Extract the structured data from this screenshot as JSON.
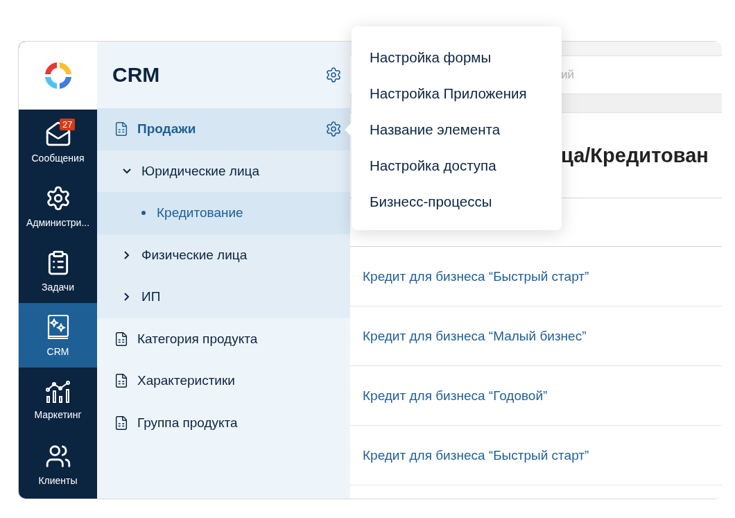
{
  "rail": [
    {
      "label": "Сообщения",
      "kind": "mail",
      "badge": "27",
      "selected": false
    },
    {
      "label": "Администри...",
      "kind": "gear",
      "selected": false
    },
    {
      "label": "Задачи",
      "kind": "tasks",
      "selected": false
    },
    {
      "label": "CRM",
      "kind": "crm",
      "selected": true
    },
    {
      "label": "Маркетинг",
      "kind": "chart",
      "selected": false
    },
    {
      "label": "Клиенты",
      "kind": "people",
      "selected": false
    }
  ],
  "sidebar": {
    "title": "CRM",
    "items": [
      {
        "label": "Продажи",
        "kind": "sheet",
        "expanded": true,
        "children": [
          {
            "label": "Юридические лица",
            "kind": "folder",
            "expanded": true,
            "selected": false,
            "children": [
              {
                "label": "Кредитование",
                "kind": "leaf",
                "selected": true
              }
            ]
          },
          {
            "label": "Физические лица",
            "kind": "folder",
            "expanded": false,
            "selected": false
          },
          {
            "label": "ИП",
            "kind": "folder",
            "expanded": false,
            "selected": false
          }
        ]
      },
      {
        "label": "Категория продукта",
        "kind": "sheet",
        "expanded": false
      },
      {
        "label": "Характеристики",
        "kind": "sheet",
        "expanded": false
      },
      {
        "label": "Группа продукта",
        "kind": "sheet",
        "expanded": false
      }
    ]
  },
  "context_menu": {
    "items": [
      "Настройка формы",
      "Настройка Приложения",
      "Название элемента",
      "Настройка доступа",
      "Бизнесс-процессы"
    ]
  },
  "main": {
    "search": {
      "placeholder": "ий"
    },
    "title": "ца/Кредитован",
    "rows": [
      "Кредит для бизнеса “Быстрый старт”",
      "Кредит для бизнеса “Малый бизнес”",
      "Кредит для бизнеса “Годовой”",
      "Кредит для бизнеса “Быстрый старт”"
    ]
  }
}
